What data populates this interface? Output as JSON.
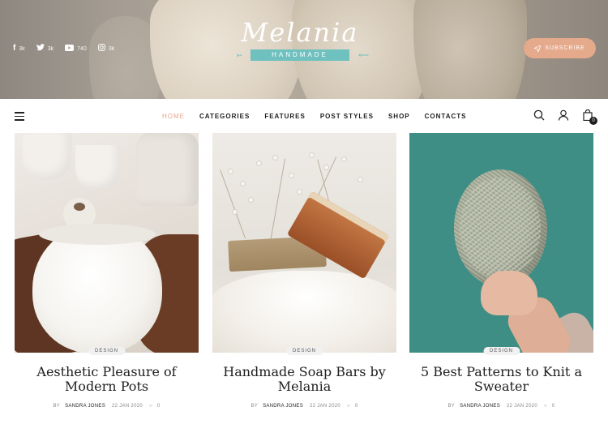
{
  "hero": {
    "logo_script": "Melania",
    "logo_sub": "HANDMADE",
    "subscribe_label": "SUBSCRIBE",
    "socials": [
      {
        "icon": "facebook-icon",
        "glyph": "f",
        "count": "3k"
      },
      {
        "icon": "twitter-icon",
        "glyph": "t",
        "count": "3k"
      },
      {
        "icon": "youtube-icon",
        "glyph": "▶",
        "count": "740"
      },
      {
        "icon": "instagram-icon",
        "glyph": "◎",
        "count": "3k"
      }
    ]
  },
  "nav": {
    "items": [
      "HOME",
      "CATEGORIES",
      "FEATURES",
      "POST STYLES",
      "SHOP",
      "CONTACTS"
    ],
    "active": "HOME",
    "cart_count": "0"
  },
  "posts": [
    {
      "tag": "DESIGN",
      "title": "Aesthetic Pleasure of Modern Pots",
      "by": "BY",
      "author": "SANDRA JONES",
      "date": "22 JAN 2020",
      "comments": "0"
    },
    {
      "tag": "DESIGN",
      "title": "Handmade Soap Bars by Melania",
      "by": "BY",
      "author": "SANDRA JONES",
      "date": "22 JAN 2020",
      "comments": "0"
    },
    {
      "tag": "DESIGN",
      "title": "5 Best Patterns to Knit a Sweater",
      "by": "BY",
      "author": "SANDRA JONES",
      "date": "22 JAN 2020",
      "comments": "0"
    }
  ],
  "colors": {
    "accent": "#e5a98b",
    "ribbon": "#6fc1c0",
    "text": "#1e1e1e"
  }
}
